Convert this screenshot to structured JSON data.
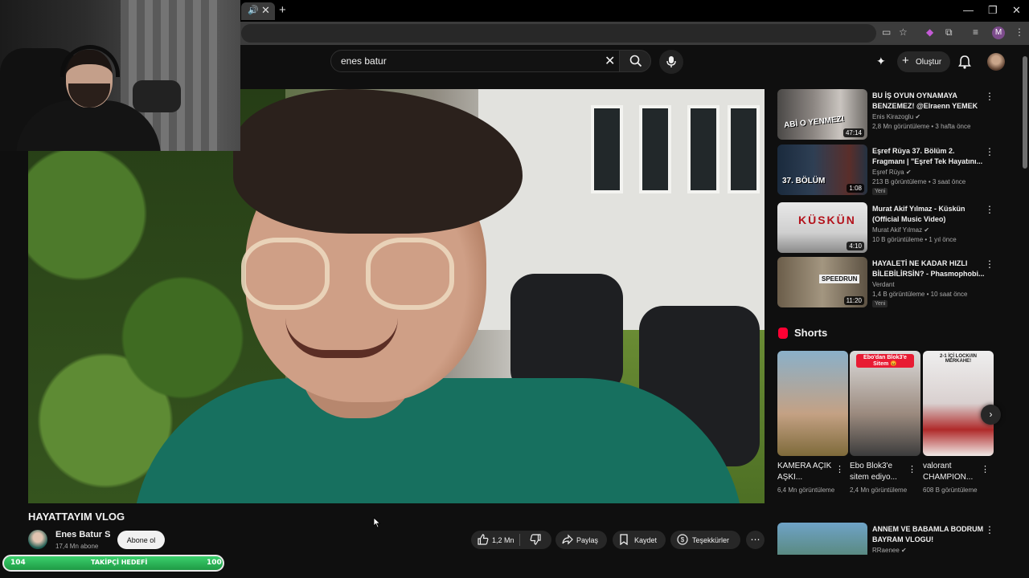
{
  "search": {
    "value": "enes batur"
  },
  "header": {
    "create_label": "Oluştur"
  },
  "video": {
    "title": "HAYATTAYIM VLOG",
    "channel_name": "Enes Batur S",
    "subscribers": "17,4 Mn abone",
    "subscribe_label": "Abone ol",
    "likes": "1,2 Mn",
    "share_label": "Paylaş",
    "save_label": "Kaydet",
    "thanks_label": "Teşekkürler"
  },
  "goal_bar": {
    "left": "104",
    "label": "TAKİPÇİ HEDEFİ",
    "right": "100"
  },
  "recommendations": [
    {
      "title": "BU İŞ OYUN OYNAMAYA BENZEMEZ! @Elraenn YEMEK ...",
      "channel": "Enis Kirazoglu",
      "meta": "2,8 Mn görüntüleme • 3 hafta önce",
      "duration": "47:14",
      "badge": "",
      "thumb_text": "ABİ O YENMEZ!"
    },
    {
      "title": "Eşref Rüya 37. Bölüm 2. Fragmanı | \"Eşref Tek Hayatını...",
      "channel": "Eşref Rüya",
      "meta": "213 B görüntüleme • 3 saat önce",
      "duration": "1:08",
      "badge": "Yeni",
      "thumb_text": "37. BÖLÜM"
    },
    {
      "title": "Murat Akif Yılmaz - Küskün (Official Music Video)",
      "channel": "Murat Akif Yılmaz",
      "meta": "10 B görüntüleme • 1 yıl önce",
      "duration": "4:10",
      "badge": "",
      "thumb_text": "KÜSKÜN"
    },
    {
      "title": "HAYALETİ NE KADAR HIZLI BİLEBİLİRSİN? - Phasmophobi...",
      "channel": "Verdant",
      "meta": "1,4 B görüntüleme • 10 saat önce",
      "duration": "11:20",
      "badge": "Yeni",
      "thumb_text": "SPEEDRUN"
    },
    {
      "title": "ANNEM VE BABAMLA BODRUM BAYRAM VLOGU!",
      "channel": "RRaenee",
      "meta": "",
      "duration": "",
      "badge": "",
      "thumb_text": ""
    }
  ],
  "shorts": {
    "heading": "Shorts",
    "items": [
      {
        "title": "KAMERA AÇIK AŞKI...",
        "views": "6,4 Mn görüntüleme",
        "caption": ""
      },
      {
        "title": "Ebo Blok3'e sitem ediyo...",
        "views": "2,4 Mn görüntüleme",
        "caption": "Ebo'dan Blok3'e Sitem 😡"
      },
      {
        "title": "valorant CHAMPION...",
        "views": "608 B görüntüleme",
        "caption": "2-1 İÇİ LOCK//IN MERKAHE!"
      }
    ]
  },
  "colors": {
    "accent_red": "#ff0033",
    "background": "#0f0f0f",
    "goal_green": "#2bb556"
  }
}
